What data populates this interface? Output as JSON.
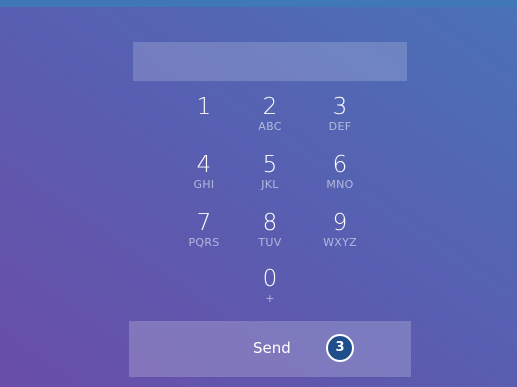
{
  "pin_field": {
    "value": ""
  },
  "keypad": {
    "keys": [
      {
        "digit": "1",
        "letters": ""
      },
      {
        "digit": "2",
        "letters": "ABC"
      },
      {
        "digit": "3",
        "letters": "DEF"
      },
      {
        "digit": "4",
        "letters": "GHI"
      },
      {
        "digit": "5",
        "letters": "JKL"
      },
      {
        "digit": "6",
        "letters": "MNO"
      },
      {
        "digit": "7",
        "letters": "PQRS"
      },
      {
        "digit": "8",
        "letters": "TUV"
      },
      {
        "digit": "9",
        "letters": "WXYZ"
      },
      {
        "digit": "0",
        "letters": "+"
      }
    ]
  },
  "send": {
    "label": "Send",
    "badge": "3"
  },
  "colors": {
    "gradient_start": "#6a4ea8",
    "gradient_end": "#4a72b8",
    "badge": "#1e4f8a"
  }
}
